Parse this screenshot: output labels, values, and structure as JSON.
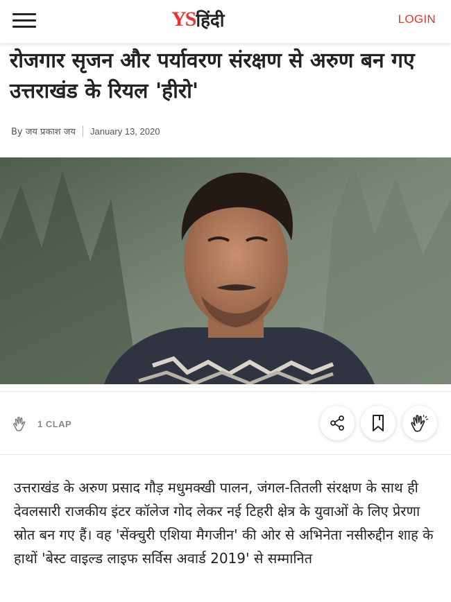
{
  "header": {
    "logo_ys": "YS",
    "logo_hindi": "हिंदी",
    "login_label": "LOGIN"
  },
  "article": {
    "title": "रोजगार सृजन और पर्यावरण संरक्षण से अरुण बन गए उत्तराखंड के रियल 'हीरो'",
    "byline": "By जय प्रकाश जय",
    "date": "January 13, 2020",
    "body": "उत्तराखंड के अरुण प्रसाद गौड़ मधुमक्खी पालन, जंगल-तितली संरक्षण के साथ ही देवलसारी राजकीय इंटर कॉलेज गोद लेकर नई टिहरी क्षेत्र के युवाओं के लिए प्रेरणा स्रोत बन गए हैं। वह 'सेंक्चुरी एशिया मैगजीन' की ओर से अभिनेता नसीरुद्दीन शाह के हाथों 'बेस्ट वाइल्ड लाइफ सर्विस अवार्ड 2019' से सम्मानित"
  },
  "actions": {
    "clap_count_label": "1 CLAP",
    "icons": [
      "clap-icon",
      "share-icon",
      "bookmark-icon",
      "clap-button-icon"
    ]
  },
  "colors": {
    "accent": "#e8342e",
    "text": "#222222",
    "muted": "#888888"
  }
}
